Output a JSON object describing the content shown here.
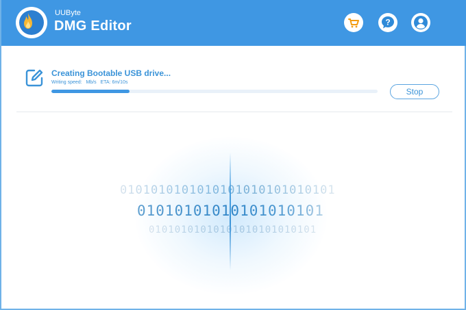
{
  "app": {
    "brand_small": "UUByte",
    "brand_title": "DMG Editor"
  },
  "header": {
    "buttons": [
      {
        "icon": "cart-icon",
        "label": "Shop"
      },
      {
        "icon": "help-icon",
        "label": "Help"
      },
      {
        "icon": "user-icon",
        "label": "Account"
      }
    ]
  },
  "task": {
    "title": "Creating Bootable USB drive...",
    "writing_speed_label": "Writing speed:",
    "writing_speed_unit": "Mb/s",
    "eta_label": "ETA:",
    "eta_value": "6m/10s",
    "progress": 0.24,
    "stop_label": "Stop"
  },
  "animation": {
    "binary_line_1": "0101010101010101010101010101",
    "binary_line_2": "01010101010101010101",
    "binary_line_3": "01010101010101010101010101"
  },
  "colors": {
    "header_bg": "#3f97e3",
    "accent": "#3a93d8",
    "cart_icon": "#f39c12",
    "help_icon": "#2f8ad8",
    "user_icon": "#2f8ad8"
  }
}
